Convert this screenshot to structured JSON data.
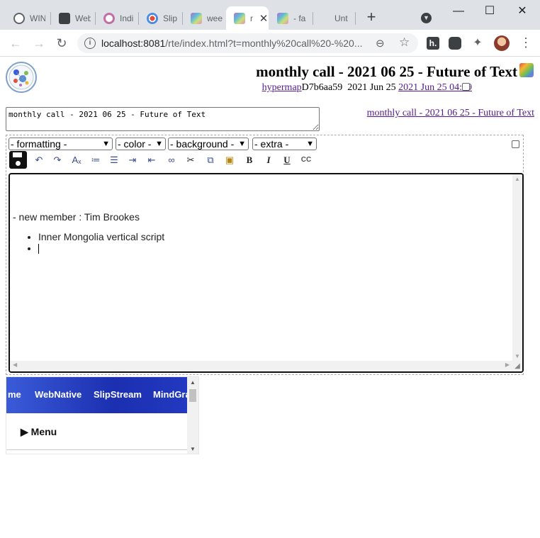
{
  "browser": {
    "tabs": [
      {
        "title": "WIN",
        "favicon": "globe-icon"
      },
      {
        "title": "Web",
        "favicon": "camera-icon"
      },
      {
        "title": "Indi",
        "favicon": "ring-icon"
      },
      {
        "title": "Slip",
        "favicon": "slipstream-icon"
      },
      {
        "title": "wee",
        "favicon": "hypermap-icon"
      },
      {
        "title": "r",
        "favicon": "hypermap-icon",
        "active": true
      },
      {
        "title": "- fa",
        "favicon": "hypermap-icon"
      },
      {
        "title": "Unt",
        "favicon": "none"
      }
    ],
    "new_tab": "+",
    "window_controls": {
      "minimize": "—",
      "maximize": "☐",
      "close": "✕"
    },
    "url_host": "localhost:8081",
    "url_path": "/rte/index.html?t=monthly%20call%20-%20...",
    "accent": "#dee1e6"
  },
  "header": {
    "title": "monthly call - 2021 06 25 - Future of Text",
    "hypermap_link": "hypermap",
    "doc_id": "D7b6aa59",
    "date": "2021 Jun 25",
    "timestamp_link": "2021 Jun 25 04:09",
    "link_color": "#551a8b"
  },
  "title_input": {
    "value": "monthly call - 2021 06 25 - Future of Text"
  },
  "title_link": "monthly call - 2021 06 25 - Future of Text",
  "editor": {
    "selects": {
      "formatting": "- formatting -",
      "color": "- color -",
      "background": "- background -",
      "extra": "- extra -"
    },
    "toolbar_icons": [
      "save-icon",
      "undo-icon",
      "redo-icon",
      "clear-format-icon",
      "ordered-list-icon",
      "unordered-list-icon",
      "indent-icon",
      "outdent-icon",
      "link-icon",
      "cut-icon",
      "copy-icon",
      "paste-icon",
      "bold-icon",
      "italic-icon",
      "underline-icon",
      "cc-icon"
    ],
    "toolbar_labels": {
      "bold": "B",
      "italic": "I",
      "underline": "U",
      "cc": "CC"
    },
    "content": {
      "line1": "- new member : Tim Brookes",
      "bullets": [
        "Inner Mongolia vertical script",
        ""
      ]
    }
  },
  "embed_nav": {
    "items": [
      "me",
      "WebNative",
      "SlipStream",
      "MindGra"
    ],
    "menu_label": "▶ Menu",
    "bar_color": "#2239c0"
  }
}
